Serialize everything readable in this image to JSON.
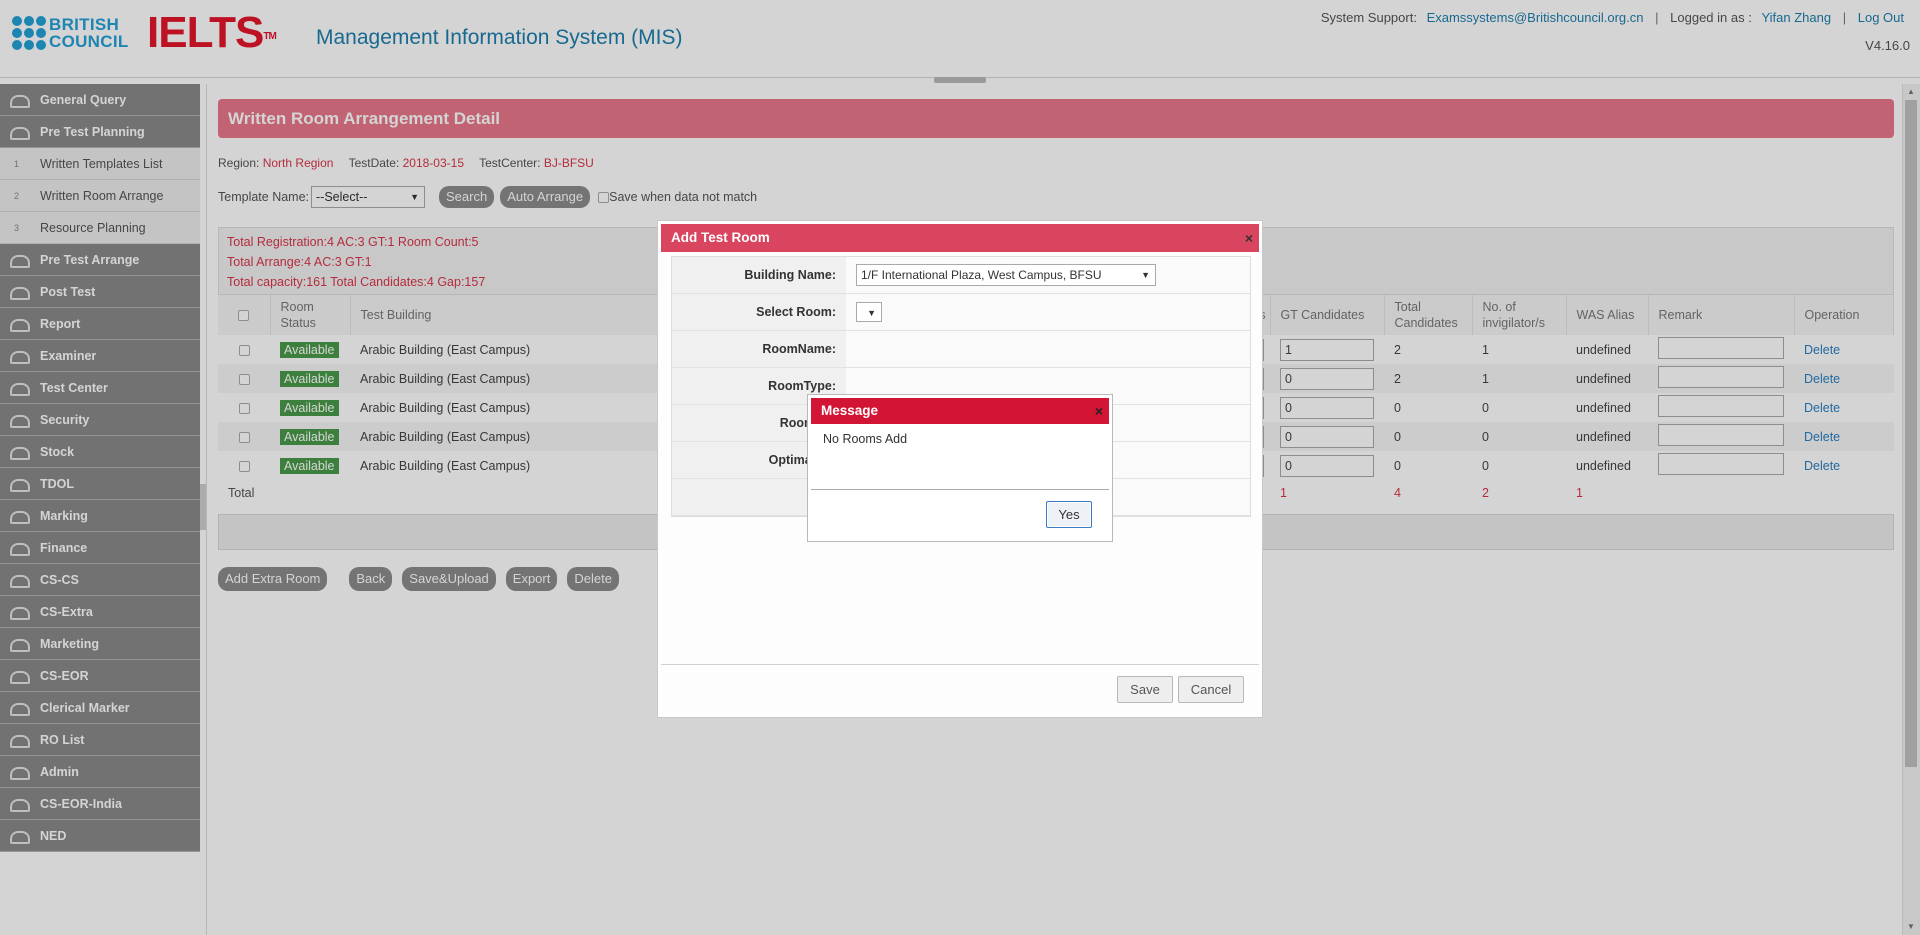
{
  "header": {
    "logo_line1": "BRITISH",
    "logo_line2": "COUNCIL",
    "ielts": "IELTS",
    "tm": "TM",
    "title": "Management Information System (MIS)",
    "support_label": "System Support:",
    "support_email": "Examssystems@Britishcouncil.org.cn",
    "logged_label": "Logged in as :",
    "user": "Yifan Zhang",
    "logout": "Log Out",
    "version": "V4.16.0",
    "separator": "|"
  },
  "sidebar": {
    "items": [
      {
        "label": "General Query",
        "type": "main"
      },
      {
        "label": "Pre Test Planning",
        "type": "main"
      },
      {
        "label": "Written Templates List",
        "type": "sub",
        "num": "1"
      },
      {
        "label": "Written Room Arrange",
        "type": "sub",
        "num": "2"
      },
      {
        "label": "Resource Planning",
        "type": "sub",
        "num": "3"
      },
      {
        "label": "Pre Test Arrange",
        "type": "main"
      },
      {
        "label": "Post Test",
        "type": "main"
      },
      {
        "label": "Report",
        "type": "main"
      },
      {
        "label": "Examiner",
        "type": "main"
      },
      {
        "label": "Test Center",
        "type": "main"
      },
      {
        "label": "Security",
        "type": "main"
      },
      {
        "label": "Stock",
        "type": "main"
      },
      {
        "label": "TDOL",
        "type": "main"
      },
      {
        "label": "Marking",
        "type": "main"
      },
      {
        "label": "Finance",
        "type": "main"
      },
      {
        "label": "CS-CS",
        "type": "main"
      },
      {
        "label": "CS-Extra",
        "type": "main"
      },
      {
        "label": "Marketing",
        "type": "main"
      },
      {
        "label": "CS-EOR",
        "type": "main"
      },
      {
        "label": "Clerical Marker",
        "type": "main"
      },
      {
        "label": "RO List",
        "type": "main"
      },
      {
        "label": "Admin",
        "type": "main"
      },
      {
        "label": "CS-EOR-India",
        "type": "main"
      },
      {
        "label": "NED",
        "type": "main"
      }
    ]
  },
  "page": {
    "title": "Written Room Arrangement Detail",
    "region_label": "Region:",
    "region": "North Region",
    "date_label": "TestDate:",
    "date": "2018-03-15",
    "center_label": "TestCenter:",
    "center": "BJ-BFSU",
    "template_label": "Template Name:",
    "template_value": "--Select--",
    "search": "Search",
    "auto_arrange": "Auto Arrange",
    "save_mismatch": "Save when data not match",
    "summary1": "Total Registration:4 AC:3 GT:1 Room Count:5",
    "summary2": "Total Arrange:4 AC:3 GT:1",
    "summary3": "Total capacity:161 Total Candidates:4 Gap:157"
  },
  "table": {
    "headers": {
      "room_status": "Room Status",
      "test_building": "Test Building",
      "s_partial": "s",
      "gt_candidates": "GT Candidates",
      "total_candidates": "Total Candidates",
      "invigilators": "No. of invigilator/s",
      "was_alias": "WAS Alias",
      "remark": "Remark",
      "operation": "Operation"
    },
    "rows": [
      {
        "status": "Available",
        "building": "Arabic Building (East Campus)",
        "gt": "1",
        "total": "2",
        "invig": "1",
        "alias": "undefined",
        "op": "Delete"
      },
      {
        "status": "Available",
        "building": "Arabic Building (East Campus)",
        "gt": "0",
        "total": "2",
        "invig": "1",
        "alias": "undefined",
        "op": "Delete"
      },
      {
        "status": "Available",
        "building": "Arabic Building (East Campus)",
        "gt": "0",
        "total": "0",
        "invig": "0",
        "alias": "undefined",
        "op": "Delete"
      },
      {
        "status": "Available",
        "building": "Arabic Building (East Campus)",
        "gt": "0",
        "total": "0",
        "invig": "0",
        "alias": "undefined",
        "op": "Delete"
      },
      {
        "status": "Available",
        "building": "Arabic Building (East Campus)",
        "gt": "0",
        "total": "0",
        "invig": "0",
        "alias": "undefined",
        "op": "Delete"
      }
    ],
    "total": {
      "label": "Total",
      "gt": "1",
      "total": "4",
      "invig": "2",
      "alias": "1"
    }
  },
  "actions": {
    "add_extra_room": "Add Extra Room",
    "back": "Back",
    "save_upload": "Save&Upload",
    "export": "Export",
    "delete": "Delete"
  },
  "dialog": {
    "title": "Add Test Room",
    "close": "×",
    "building_label": "Building Name:",
    "building_value": "1/F International Plaza, West Campus, BFSU",
    "room_label": "Select Room:",
    "roomname_label": "RoomName:",
    "roomtype_label": "RoomType:",
    "roomq_label": "Room Qu",
    "optimal_label": "Optimal Qu",
    "price_label": "Pric",
    "save": "Save",
    "cancel": "Cancel"
  },
  "message": {
    "title": "Message",
    "close": "×",
    "text": "No Rooms Add",
    "yes": "Yes"
  }
}
